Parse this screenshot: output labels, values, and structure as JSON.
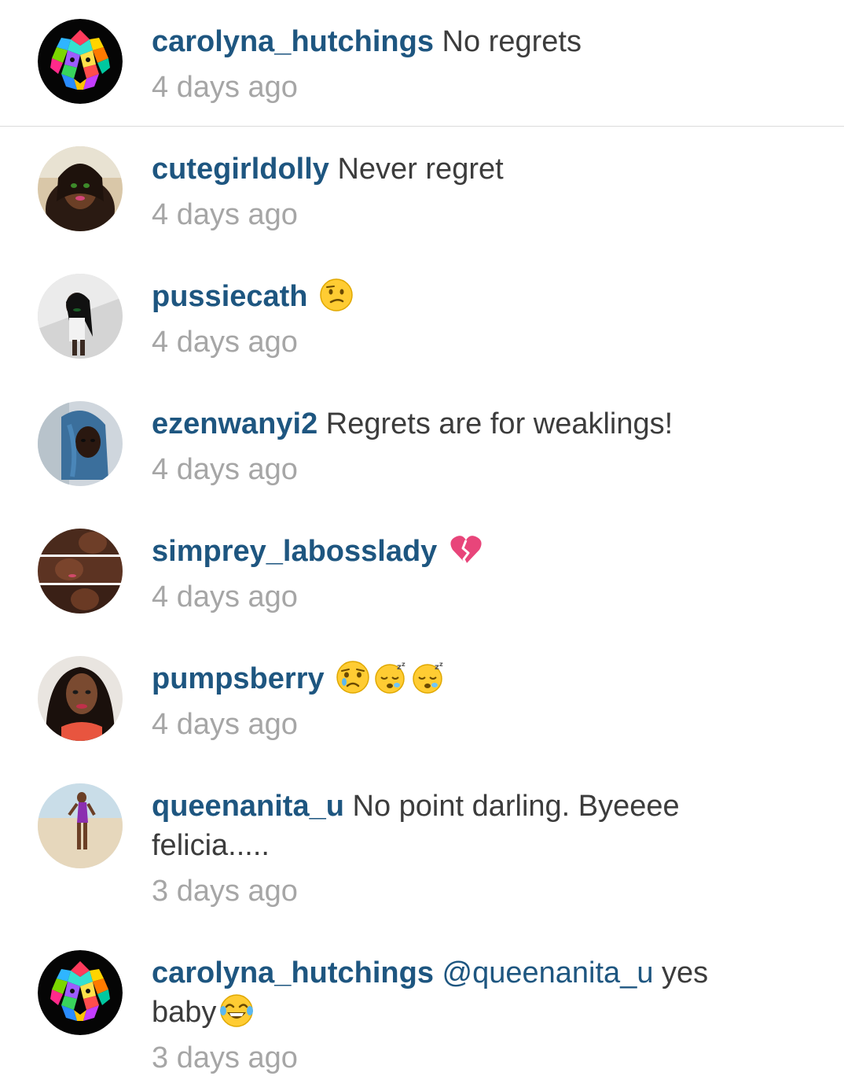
{
  "comments": [
    {
      "username": "carolyna_hutchings",
      "text": "No regrets",
      "time": "4 days ago",
      "avatar": "lion-avatar"
    },
    {
      "username": "cutegirldolly",
      "text": "Never regret",
      "time": "4 days ago",
      "avatar": "profile-photo"
    },
    {
      "username": "pussiecath",
      "text": "",
      "emoji": "confused-face-emoji",
      "time": "4 days ago",
      "avatar": "profile-photo"
    },
    {
      "username": "ezenwanyi2",
      "text": "Regrets are for weaklings!",
      "time": "4 days ago",
      "avatar": "profile-photo"
    },
    {
      "username": "simprey_labosslady",
      "text": "",
      "emoji": "broken-heart-emoji",
      "time": "4 days ago",
      "avatar": "profile-photo"
    },
    {
      "username": "pumpsberry",
      "text": "",
      "emoji": "crying-face-emoji sleeping-face-emoji sleeping-face-emoji",
      "time": "4 days ago",
      "avatar": "profile-photo"
    },
    {
      "username": "queenanita_u",
      "text": "No point darling. Byeeee felicia.....",
      "time": "3 days ago",
      "avatar": "profile-photo"
    },
    {
      "username": "carolyna_hutchings",
      "mention": "@queenanita_u",
      "text": "yes baby",
      "emoji": "tears-of-joy-emoji",
      "time": "3 days ago",
      "avatar": "lion-avatar"
    }
  ],
  "colors": {
    "username": "#1e5680",
    "text": "#3c3c3c",
    "time": "#a6a6a6",
    "divider": "#dbdbdb"
  }
}
